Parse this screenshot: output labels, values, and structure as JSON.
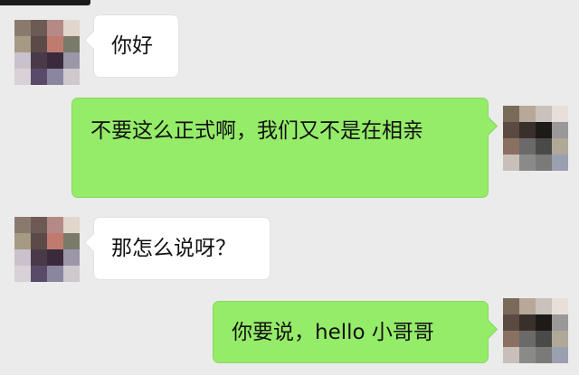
{
  "chat": {
    "messages": [
      {
        "direction": "incoming",
        "text": "你好"
      },
      {
        "direction": "outgoing",
        "text": "不要这么正式啊，我们又不是在相亲"
      },
      {
        "direction": "incoming",
        "text": "那怎么说呀？"
      },
      {
        "direction": "outgoing",
        "text": "你要说，hello 小哥哥"
      }
    ]
  },
  "colors": {
    "background": "#ebebeb",
    "incoming_bubble": "#ffffff",
    "outgoing_bubble": "#95ec69"
  },
  "avatars": {
    "friend": [
      "#8a7a6e",
      "#6e5a55",
      "#b58a86",
      "#e0d6cc",
      "#a59a82",
      "#5c4a49",
      "#c07b6e",
      "#7a7a6a",
      "#c9c2cc",
      "#4a3a48",
      "#3a2a3c",
      "#9b96a8",
      "#d8d2d8",
      "#5a4a6a",
      "#8a86a0",
      "#cfc8cc"
    ],
    "me": [
      "#7a6a5a",
      "#b8a89a",
      "#c9c2ba",
      "#e6e0d8",
      "#5a4a42",
      "#3a302a",
      "#1e1a18",
      "#9a9898",
      "#8a7060",
      "#6a6a6a",
      "#4a4a48",
      "#b0a898",
      "#c8c0b8",
      "#8a8a8a",
      "#7a7a78",
      "#9aa0b0"
    ]
  }
}
